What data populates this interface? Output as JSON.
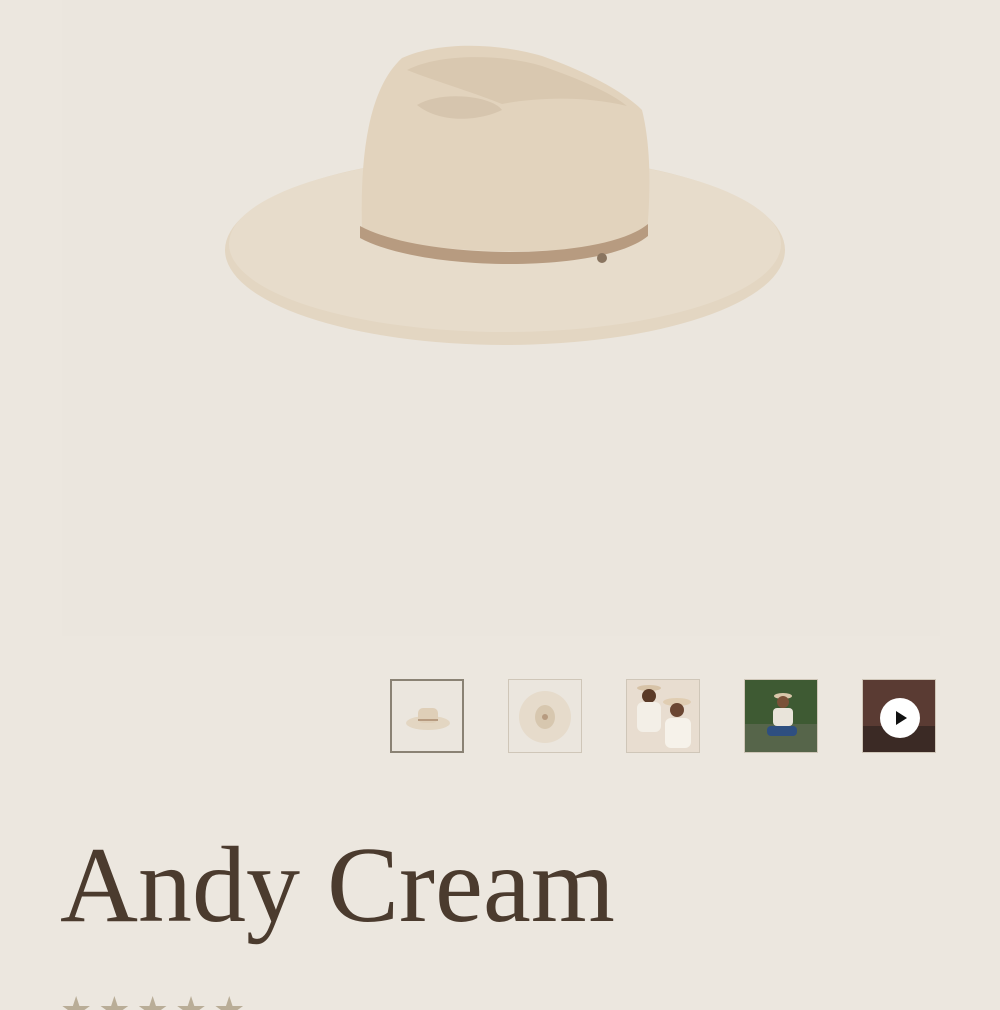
{
  "product": {
    "title": "Andy Cream",
    "rating_stars": "★★★★★"
  },
  "gallery": {
    "main_image": "cream-wide-brim-felt-hat",
    "thumbnails": [
      {
        "name": "hat-side-view",
        "active": true
      },
      {
        "name": "hat-top-view",
        "active": false
      },
      {
        "name": "couple-wearing-hats",
        "active": false
      },
      {
        "name": "man-seated-outdoors",
        "active": false
      },
      {
        "name": "video",
        "active": false,
        "icon": "play-icon"
      }
    ]
  },
  "colors": {
    "background": "#ece7df",
    "hat": "#e4d7c3",
    "band": "#b79b80",
    "title": "#4b3b2e"
  }
}
